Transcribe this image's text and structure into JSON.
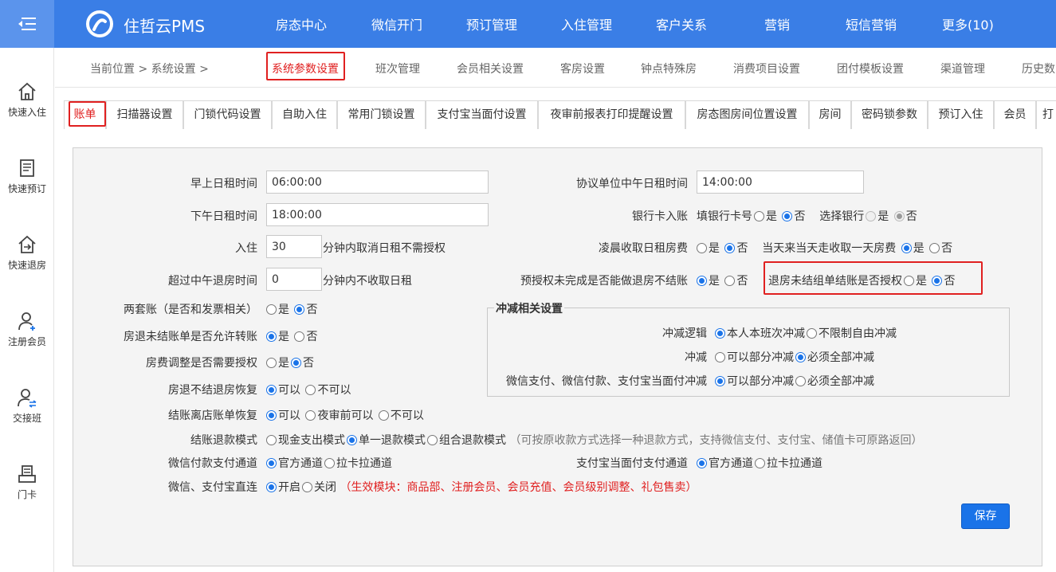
{
  "topbar": {
    "brand": "住哲云PMS",
    "nav": [
      "房态中心",
      "微信开门",
      "预订管理",
      "入住管理",
      "客户关系",
      "营销",
      "短信营销",
      "更多(10)"
    ]
  },
  "sidebar": {
    "items": [
      {
        "label": "快速入住",
        "icon": "home-icon"
      },
      {
        "label": "快速预订",
        "icon": "booking-icon"
      },
      {
        "label": "快速退房",
        "icon": "checkout-icon"
      },
      {
        "label": "注册会员",
        "icon": "add-user-icon"
      },
      {
        "label": "交接班",
        "icon": "shift-icon"
      },
      {
        "label": "门卡",
        "icon": "card-icon"
      }
    ]
  },
  "breadcrumb": {
    "text": "当前位置 > 系统设置 >"
  },
  "tabs": [
    "系统参数设置",
    "班次管理",
    "会员相关设置",
    "客房设置",
    "钟点特殊房",
    "消费项目设置",
    "团付模板设置",
    "渠道管理",
    "历史数"
  ],
  "subtabs": [
    "账单",
    "扫描器设置",
    "门锁代码设置",
    "自助入住",
    "常用门锁设置",
    "支付宝当面付设置",
    "夜审前报表打印提醒设置",
    "房态图房间位置设置",
    "房间",
    "密码锁参数",
    "预订入住",
    "会员",
    "打"
  ],
  "form": {
    "morning_label": "早上日租时间",
    "morning_value": "06:00:00",
    "afternoon_label": "下午日租时间",
    "afternoon_value": "18:00:00",
    "checkin_label": "入住",
    "checkin_value": "30",
    "checkin_suffix": "分钟内取消日租不需授权",
    "noon_label": "超过中午退房时间",
    "noon_value": "0",
    "noon_suffix": "分钟内不收取日租",
    "two_bills_label": "两套账（是否和发票相关）",
    "transfer_label": "房退未结账单是否允许转账",
    "roomfee_label": "房费调整是否需要授权",
    "restore_label": "房退不结退房恢复",
    "store_label": "结账离店账单恢复",
    "refund_label": "结账退款模式",
    "refund_opts": [
      "现金支出模式",
      "单一退款模式",
      "组合退款模式"
    ],
    "refund_note": "（可按原收款方式选择一种退款方式，支持微信支付、支付宝、储值卡可原路返回）",
    "wx_channel_label": "微信付款支付通道",
    "channel_opts": [
      "官方通道",
      "拉卡拉通道"
    ],
    "direct_label": "微信、支付宝直连",
    "direct_opts": [
      "开启",
      "关闭"
    ],
    "direct_note": "（生效模块：商品部、注册会员、会员充值、会员级别调整、礼包售卖）",
    "proto_label": "协议单位中午日租时间",
    "proto_value": "14:00:00",
    "bank_label": "银行卡入账",
    "bank_fill_label": "填银行卡号",
    "bank_select_label": "选择银行",
    "dawn_label": "凌晨收取日租房费",
    "sameday_label": "当天来当天走收取一天房费",
    "preauth_label": "预授权未完成是否能做退房不结账",
    "group_label": "退房未结组单结账是否授权",
    "alipay_channel_label": "支付宝当面付支付通道",
    "yes": "是",
    "no": "否",
    "can": "可以",
    "cannot": "不可以",
    "before_audit": "夜审前可以",
    "save": "保存"
  },
  "offset": {
    "legend": "冲减相关设置",
    "logic_label": "冲减逻辑",
    "logic_opts": [
      "本人本班次冲减",
      "不限制自由冲减"
    ],
    "mode_label": "冲减",
    "mode_opts": [
      "可以部分冲减",
      "必须全部冲减"
    ],
    "pay_label": "微信支付、微信付款、支付宝当面付冲减",
    "pay_opts": [
      "可以部分冲减",
      "必须全部冲减"
    ]
  },
  "colors": {
    "topbar": "#3a7ee6",
    "accent": "#1a73e8",
    "highlight": "#e02020"
  }
}
